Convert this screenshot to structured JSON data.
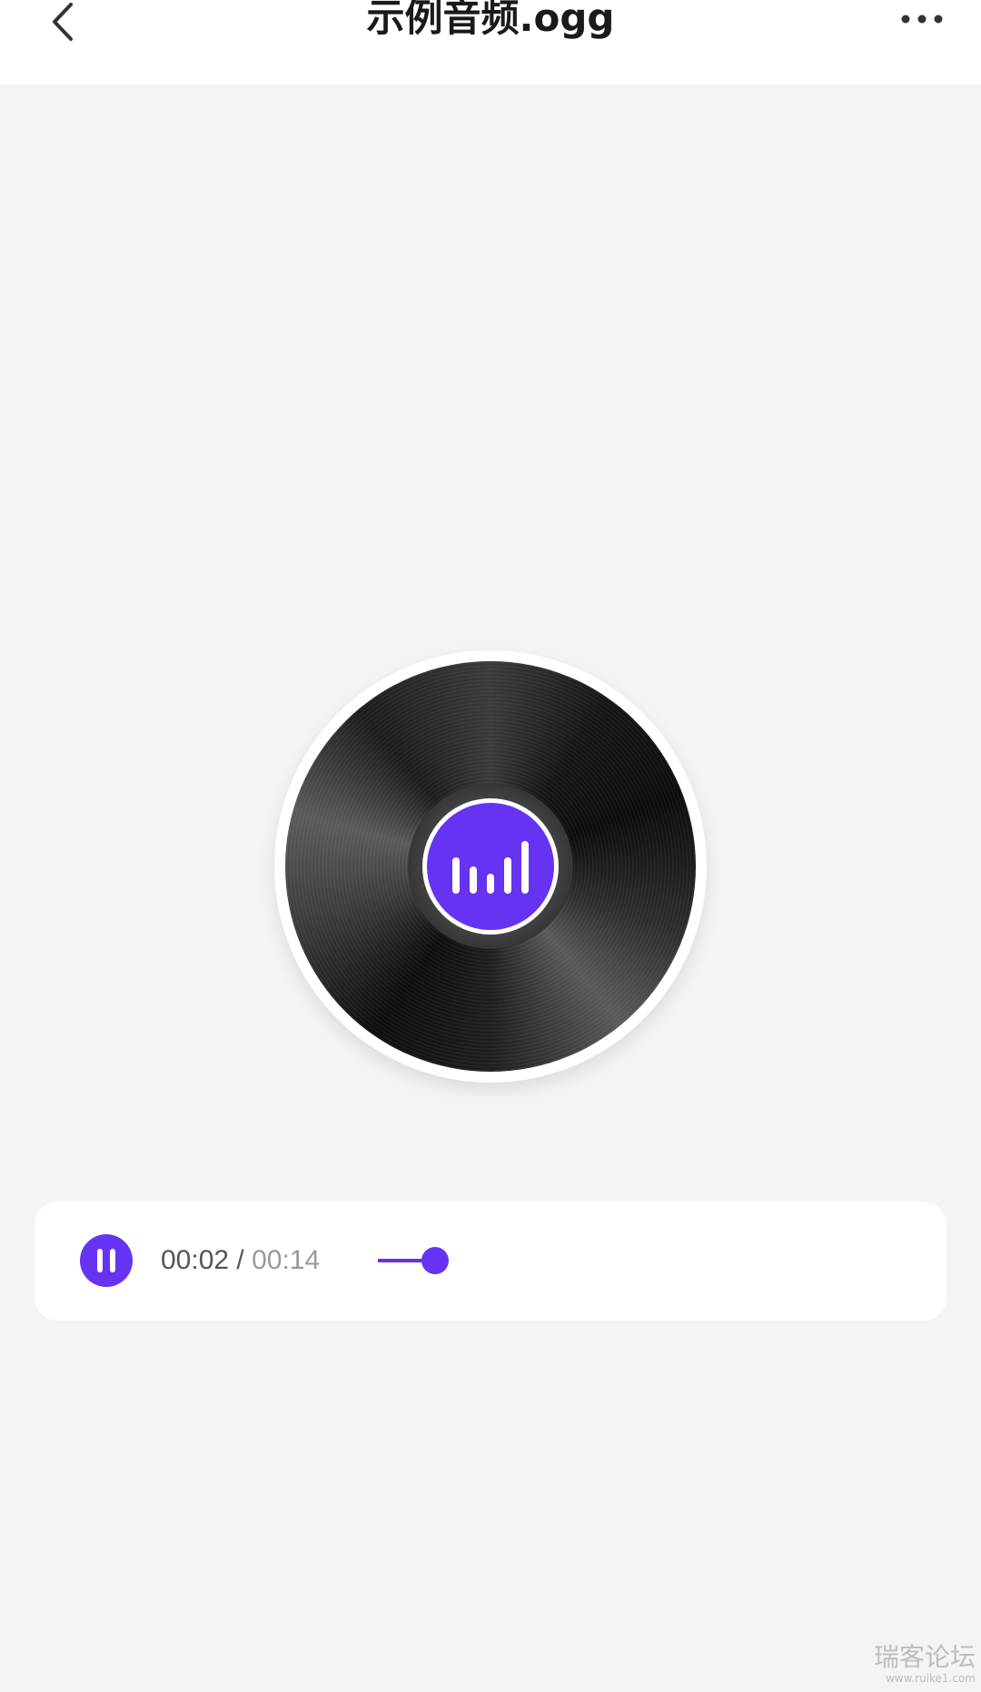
{
  "header": {
    "title": "示例音频.ogg",
    "back_icon": "chevron-left-icon",
    "more_icon": "more-horizontal-icon"
  },
  "record": {
    "label_icon": "audio-bars-icon",
    "label_color": "#6633f2"
  },
  "player": {
    "state_icon": "pause-icon",
    "current_time": "00:02",
    "separator": " / ",
    "total_time": "00:14",
    "progress_fraction": 0.14,
    "accent_color": "#6633f2"
  },
  "watermark": {
    "main": "瑞客论坛",
    "sub": "www.ruike1.com"
  }
}
